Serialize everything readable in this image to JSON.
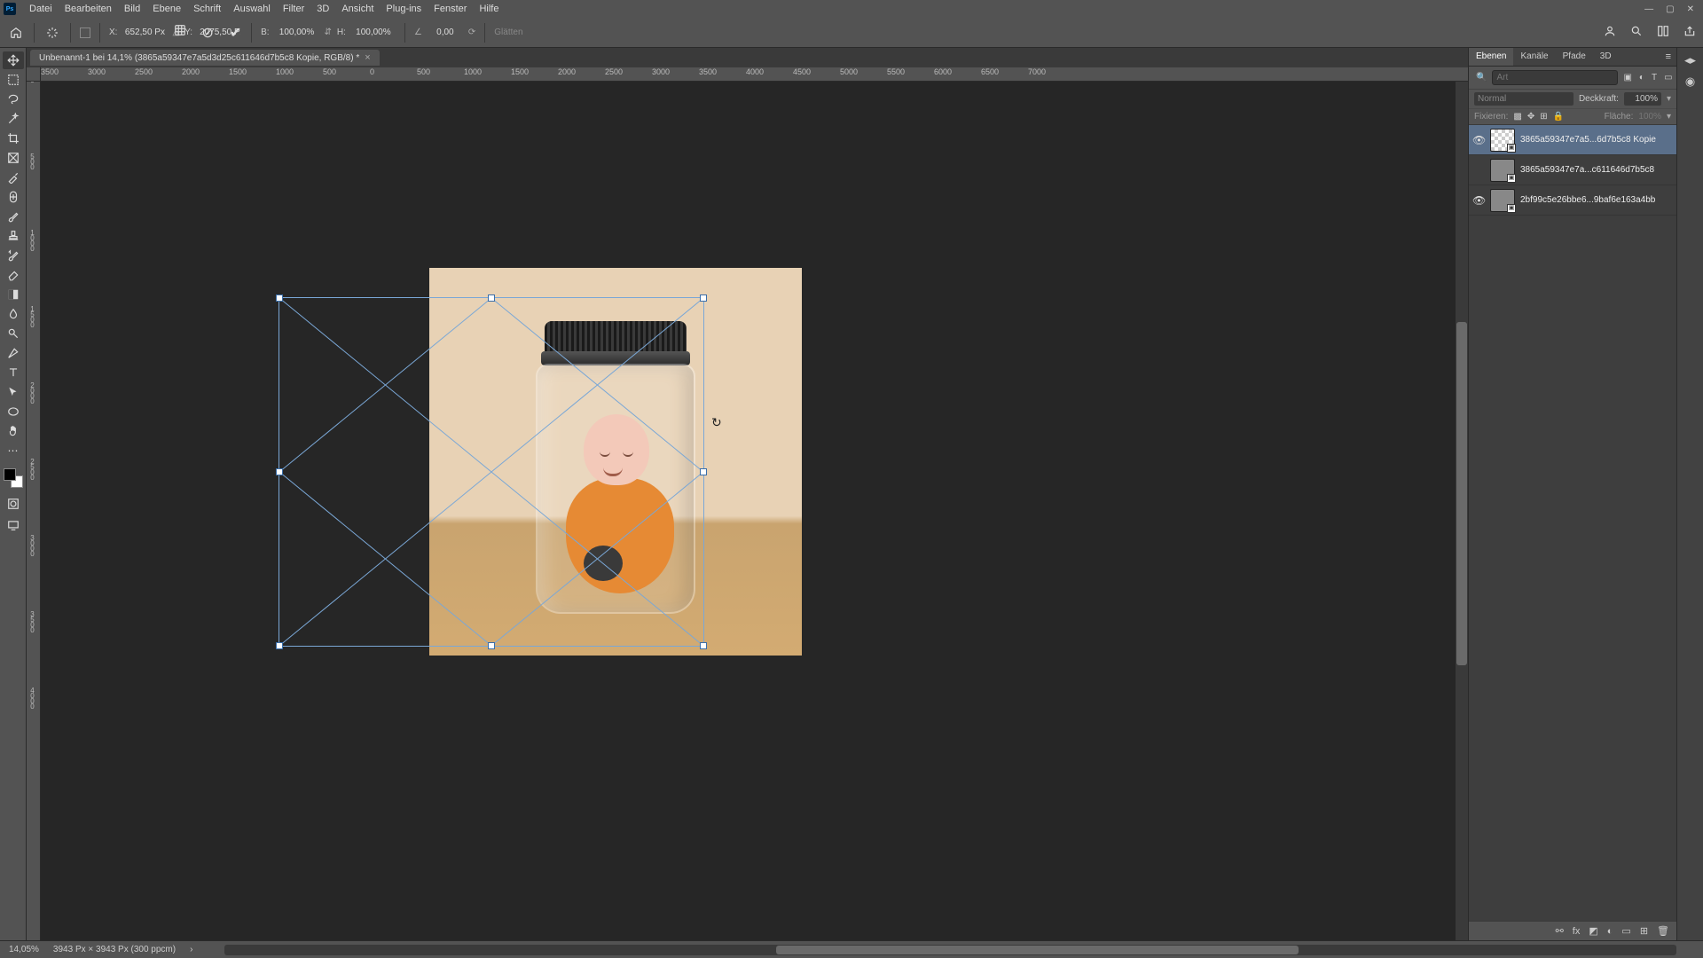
{
  "menu": [
    "Datei",
    "Bearbeiten",
    "Bild",
    "Ebene",
    "Schrift",
    "Auswahl",
    "Filter",
    "3D",
    "Ansicht",
    "Plug-ins",
    "Fenster",
    "Hilfe"
  ],
  "options": {
    "x_label": "X:",
    "x_val": "652,50 Px",
    "y_label": "Y:",
    "y_val": "2075,50 Px",
    "w_label": "B:",
    "w_val": "100,00%",
    "h_label": "H:",
    "h_val": "100,00%",
    "angle_val": "0,00",
    "glatten": "Glätten"
  },
  "doc_tab": "Unbenannt-1 bei 14,1% (3865a59347e7a5d3d25c611646d7b5c8 Kopie, RGB/8) *",
  "ruler_h": [
    "3500",
    "3000",
    "2500",
    "2000",
    "1500",
    "1000",
    "500",
    "0",
    "500",
    "1000",
    "1500",
    "2000",
    "2500",
    "3000",
    "3500",
    "4000",
    "4500",
    "5000",
    "5500",
    "6000",
    "6500",
    "7000"
  ],
  "ruler_v": [
    "0",
    "500",
    "1000",
    "1500",
    "2000",
    "2500",
    "3000",
    "3500",
    "4000"
  ],
  "panel_tabs": {
    "ebenen": "Ebenen",
    "kanale": "Kanäle",
    "pfade": "Pfade",
    "d3": "3D"
  },
  "search_placeholder": "Art",
  "blend_mode": "Normal",
  "opacity_label": "Deckkraft:",
  "opacity_val": "100%",
  "lock_label": "Fixieren:",
  "fill_label": "Fläche:",
  "fill_val": "100%",
  "layers": [
    {
      "name": "3865a59347e7a5...6d7b5c8 Kopie",
      "visible": true,
      "selected": true,
      "checker": true
    },
    {
      "name": "3865a59347e7a...c611646d7b5c8",
      "visible": false,
      "selected": false,
      "checker": false
    },
    {
      "name": "2bf99c5e26bbe6...9baf6e163a4bb",
      "visible": true,
      "selected": false,
      "checker": false
    }
  ],
  "status": {
    "zoom": "14,05%",
    "docinfo": "3943 Px × 3943 Px (300 ppcm)"
  }
}
